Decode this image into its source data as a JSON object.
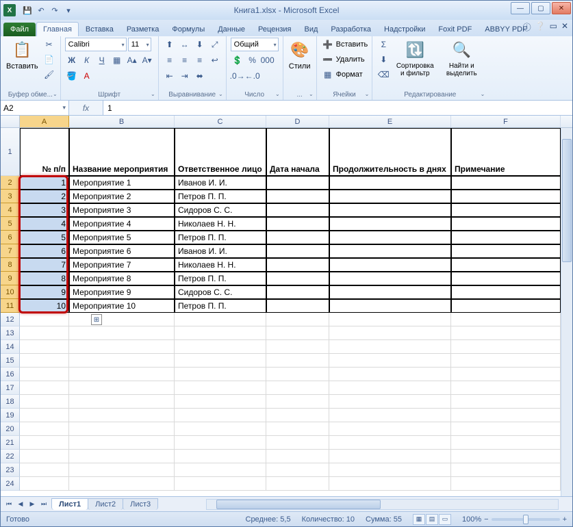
{
  "window": {
    "title": "Книга1.xlsx - Microsoft Excel"
  },
  "qat": {
    "save": "💾",
    "undo": "↶",
    "redo": "↷"
  },
  "tabs": {
    "file": "Файл",
    "items": [
      "Главная",
      "Вставка",
      "Разметка",
      "Формулы",
      "Данные",
      "Рецензия",
      "Вид",
      "Разработка",
      "Надстройки",
      "Foxit PDF",
      "ABBYY PDF"
    ],
    "active_index": 0
  },
  "ribbon": {
    "clipboard": {
      "label": "Буфер обме...",
      "paste": "Вставить"
    },
    "font": {
      "label": "Шрифт",
      "name": "Calibri",
      "size": "11",
      "bold": "Ж",
      "italic": "К",
      "underline": "Ч"
    },
    "alignment": {
      "label": "Выравнивание"
    },
    "number": {
      "label": "Число",
      "format": "Общий"
    },
    "styles": {
      "label": "...",
      "btn": "Стили"
    },
    "cells": {
      "label": "Ячейки",
      "insert": "Вставить",
      "delete": "Удалить",
      "format": "Формат"
    },
    "editing": {
      "label": "Редактирование",
      "sort": "Сортировка и фильтр",
      "find": "Найти и выделить"
    }
  },
  "formula_bar": {
    "name_box": "A2",
    "formula": "1",
    "fx": "fx"
  },
  "columns": [
    "A",
    "B",
    "C",
    "D",
    "E",
    "F"
  ],
  "headers": {
    "A": "№ п/п",
    "B": "Название мероприятия",
    "C": "Ответственное лицо",
    "D": "Дата начала",
    "E": "Продолжительность в днях",
    "F": "Примечание"
  },
  "rows": [
    {
      "n": "1",
      "name": "Мероприятие 1",
      "person": "Иванов И. И."
    },
    {
      "n": "2",
      "name": "Мероприятие 2",
      "person": "Петров П. П."
    },
    {
      "n": "3",
      "name": "Мероприятие 3",
      "person": "Сидоров С. С."
    },
    {
      "n": "4",
      "name": "Мероприятие 4",
      "person": "Николаев Н. Н."
    },
    {
      "n": "5",
      "name": "Мероприятие 5",
      "person": "Петров П. П."
    },
    {
      "n": "6",
      "name": "Мероприятие 6",
      "person": "Иванов И. И."
    },
    {
      "n": "7",
      "name": "Мероприятие 7",
      "person": "Николаев Н. Н."
    },
    {
      "n": "8",
      "name": "Мероприятие 8",
      "person": "Петров П. П."
    },
    {
      "n": "9",
      "name": "Мероприятие 9",
      "person": "Сидоров С. С."
    },
    {
      "n": "10",
      "name": "Мероприятие 10",
      "person": "Петров П. П."
    }
  ],
  "sheets": {
    "items": [
      "Лист1",
      "Лист2",
      "Лист3"
    ],
    "active_index": 0
  },
  "status": {
    "ready": "Готово",
    "average_label": "Среднее:",
    "average": "5,5",
    "count_label": "Количество:",
    "count": "10",
    "sum_label": "Сумма:",
    "sum": "55",
    "zoom": "100%"
  },
  "autofill": "⊞"
}
